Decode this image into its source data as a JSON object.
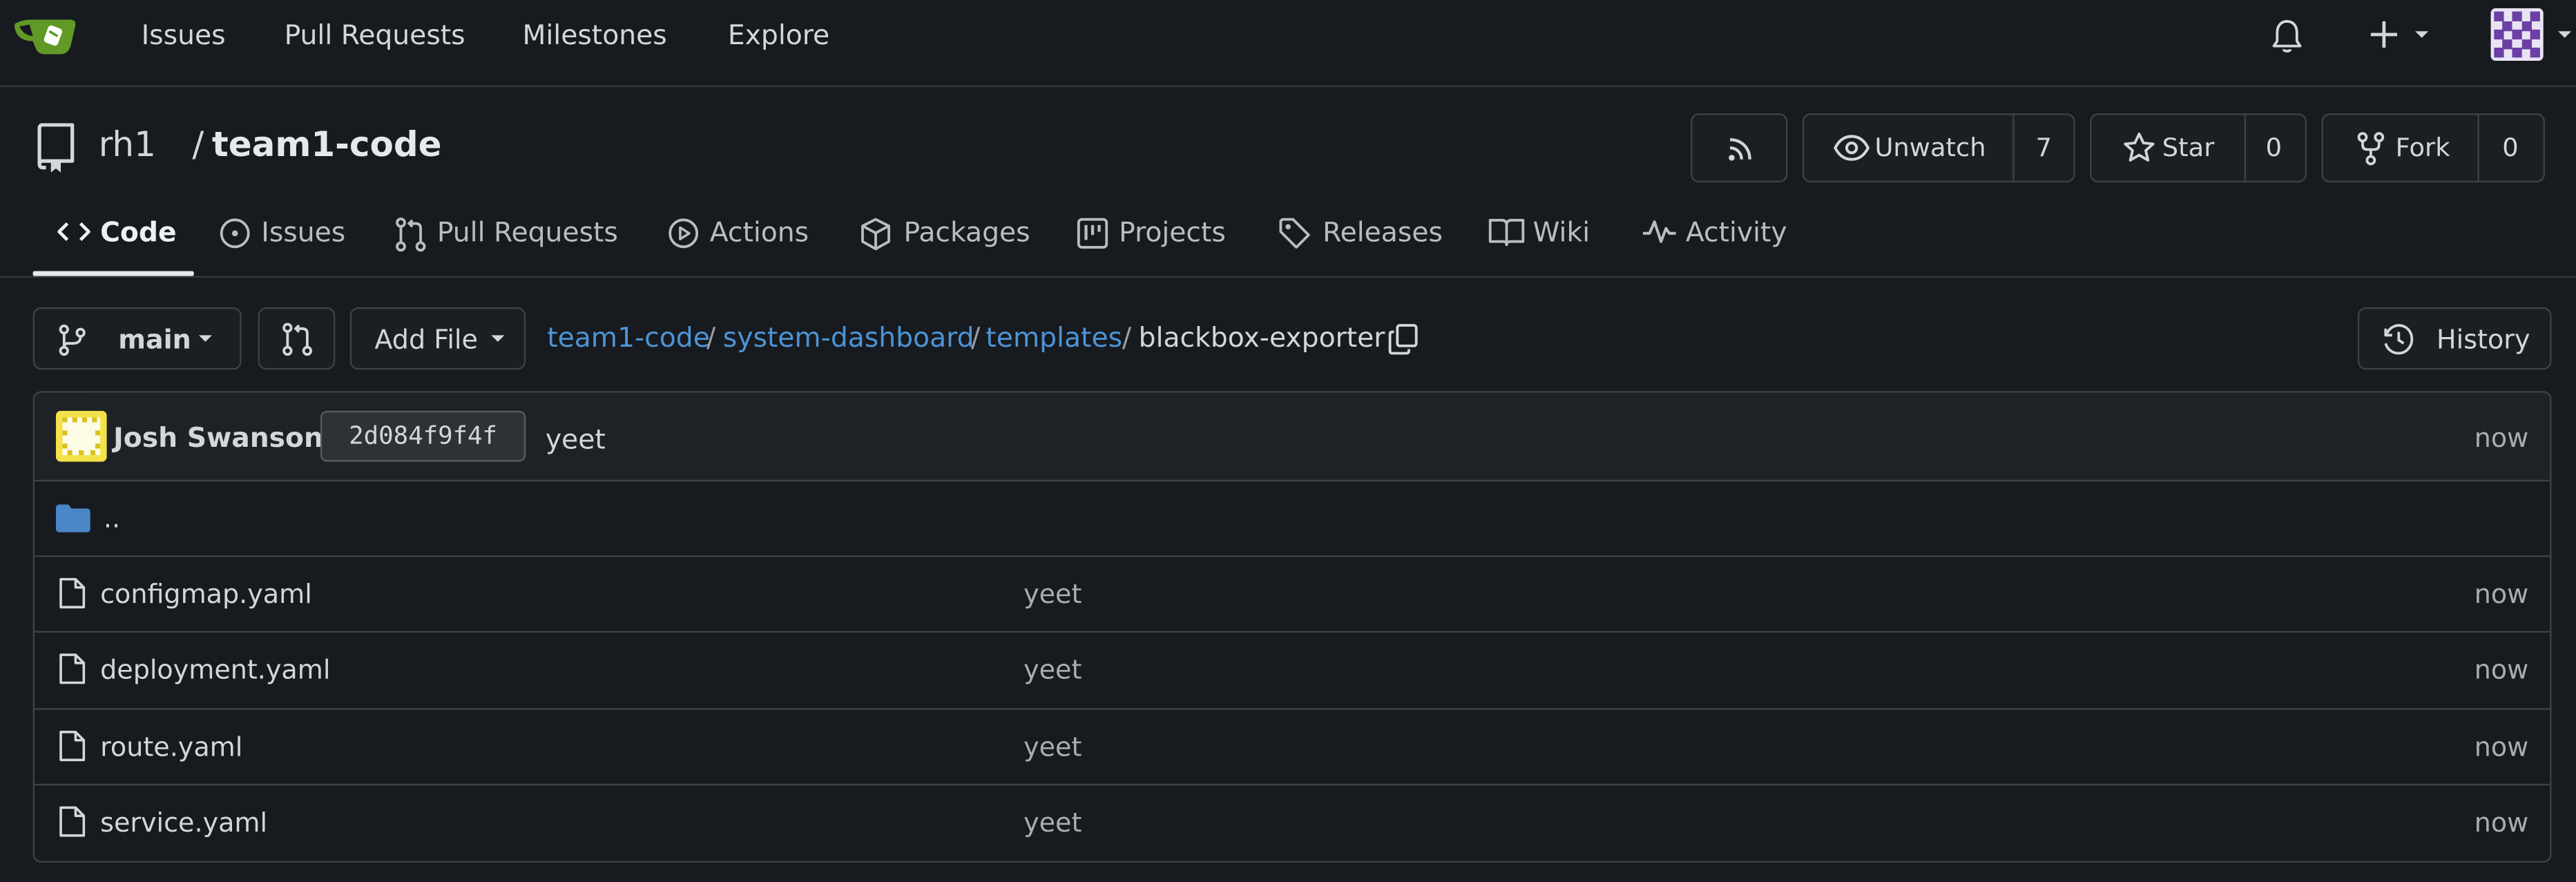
{
  "topnav": {
    "links": [
      "Issues",
      "Pull Requests",
      "Milestones",
      "Explore"
    ]
  },
  "repo": {
    "owner": "rh1",
    "separator": "/",
    "name": "team1-code",
    "watch_label": "Unwatch",
    "watch_count": "7",
    "star_label": "Star",
    "star_count": "0",
    "fork_label": "Fork",
    "fork_count": "0"
  },
  "tabs": {
    "code": "Code",
    "issues": "Issues",
    "pulls": "Pull Requests",
    "actions": "Actions",
    "packages": "Packages",
    "projects": "Projects",
    "releases": "Releases",
    "wiki": "Wiki",
    "activity": "Activity"
  },
  "pathbar": {
    "branch": "main",
    "add_file": "Add File",
    "crumbs": [
      "team1-code",
      "system-dashboard",
      "templates"
    ],
    "sep": "/",
    "current": "blackbox-exporter",
    "history": "History"
  },
  "commit": {
    "author": "Josh Swanson",
    "sha": "2d084f9f4f",
    "message": "yeet",
    "time": "now"
  },
  "parent_dir": "..",
  "files": [
    {
      "name": "configmap.yaml",
      "message": "yeet",
      "time": "now"
    },
    {
      "name": "deployment.yaml",
      "message": "yeet",
      "time": "now"
    },
    {
      "name": "route.yaml",
      "message": "yeet",
      "time": "now"
    },
    {
      "name": "service.yaml",
      "message": "yeet",
      "time": "now"
    }
  ],
  "colors": {
    "background": "#171a1e",
    "link": "#4d94d6",
    "folder": "#4a86c8",
    "logo_green": "#609926"
  },
  "icons": [
    "gitea-logo-icon",
    "bell-icon",
    "plus-icon",
    "avatar",
    "repo-icon",
    "rss-icon",
    "eye-icon",
    "star-icon",
    "fork-icon",
    "code-icon",
    "issue-icon",
    "pull-request-icon",
    "play-icon",
    "package-icon",
    "project-icon",
    "tag-icon",
    "book-icon",
    "pulse-icon",
    "branch-icon",
    "compare-icon",
    "copy-icon",
    "history-icon",
    "folder-icon",
    "file-icon"
  ]
}
